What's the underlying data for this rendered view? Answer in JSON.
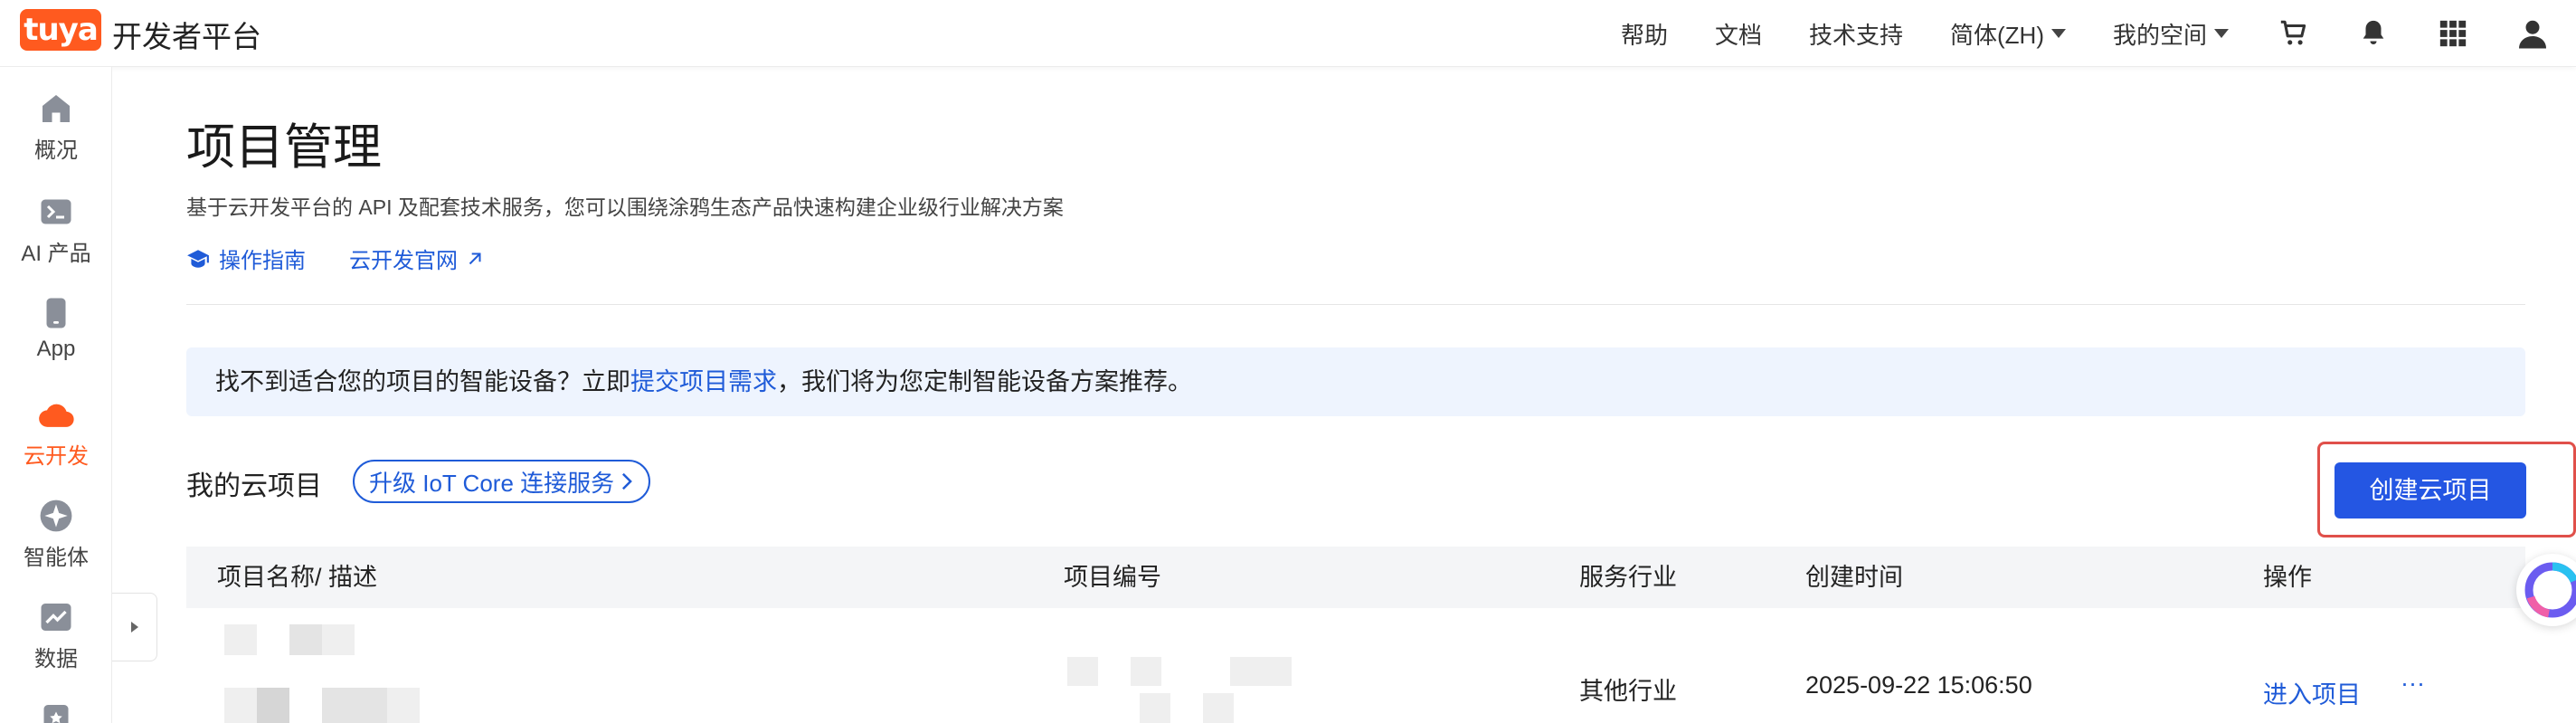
{
  "brand": {
    "logo_text": "tuya",
    "title": "开发者平台",
    "color": "#ff5a1f"
  },
  "topnav": {
    "items": [
      {
        "label": "帮助"
      },
      {
        "label": "文档"
      },
      {
        "label": "技术支持"
      },
      {
        "label": "简体(ZH)",
        "dropdown": true
      },
      {
        "label": "我的空间",
        "dropdown": true
      }
    ],
    "icons": [
      "cart-icon",
      "bell-icon",
      "apps-grid-icon",
      "user-icon"
    ]
  },
  "sidebar": {
    "items": [
      {
        "label": "概况",
        "icon": "home-icon"
      },
      {
        "label": "AI 产品",
        "icon": "terminal-icon"
      },
      {
        "label": "App",
        "icon": "phone-icon"
      },
      {
        "label": "云开发",
        "icon": "cloud-icon",
        "active": true
      },
      {
        "label": "智能体",
        "icon": "compass-icon"
      },
      {
        "label": "数据",
        "icon": "chart-icon"
      }
    ]
  },
  "page": {
    "title": "项目管理",
    "description": "基于云开发平台的 API 及配套技术服务，您可以围绕涂鸦生态产品快速构建企业级行业解决方案",
    "links": [
      {
        "label": "操作指南",
        "icon": "graduation-cap-icon"
      },
      {
        "label": "云开发官网",
        "icon": "external-link-icon"
      }
    ]
  },
  "notice": {
    "prefix": "找不到适合您的项目的智能设备？立即",
    "link": "提交项目需求",
    "suffix": "，我们将为您定制智能设备方案推荐。"
  },
  "projects": {
    "section_title": "我的云项目",
    "upgrade_label": "升级 IoT Core 连接服务",
    "create_label": "创建云项目",
    "columns": [
      "项目名称/ 描述",
      "项目编号",
      "服务行业",
      "创建时间",
      "操作"
    ],
    "rows": [
      {
        "industry": "其他行业",
        "created": "2025-09-22 15:06:50",
        "action": "进入项目",
        "more": "···"
      }
    ]
  },
  "colors": {
    "accent": "#ff5a1f",
    "link": "#1f5bd8",
    "primary_button": "#2456e3",
    "highlight_border": "#e0504a"
  }
}
